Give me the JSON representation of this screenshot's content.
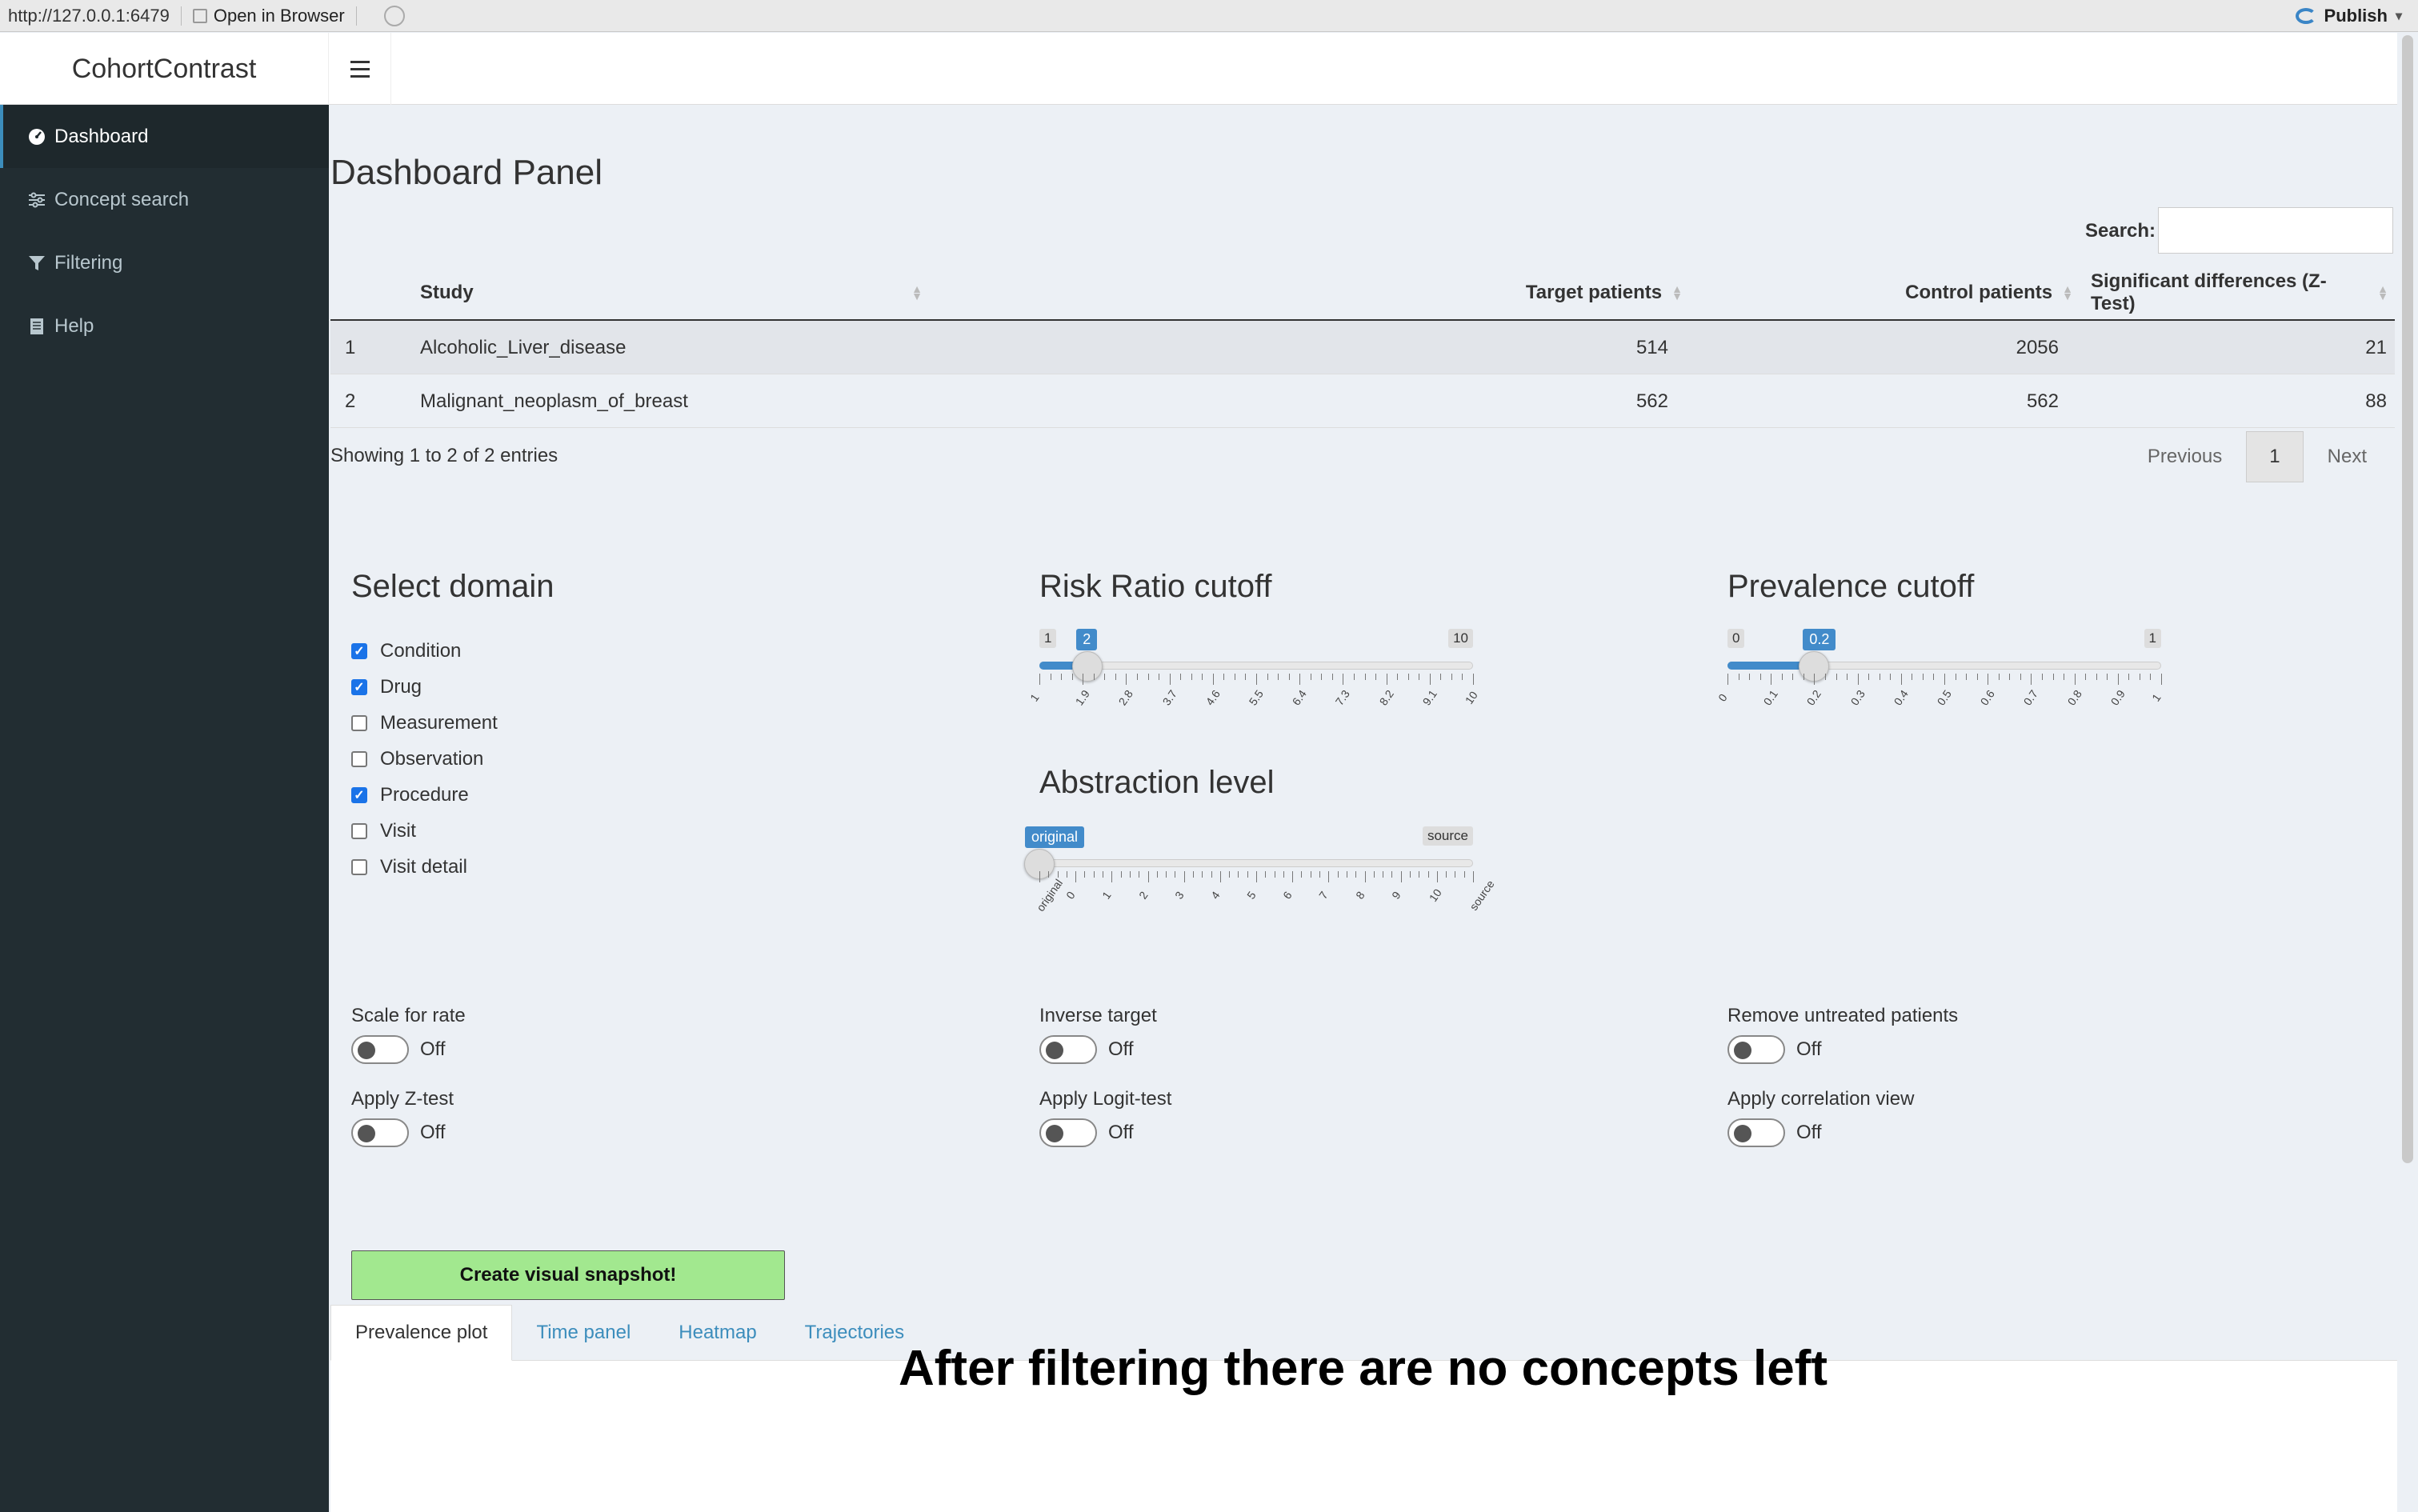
{
  "browser": {
    "url": "http://127.0.0.1:6479",
    "open_label": "Open in Browser",
    "publish_label": "Publish"
  },
  "app": {
    "title": "CohortContrast"
  },
  "sidebar": {
    "items": [
      {
        "label": "Dashboard",
        "icon": "dashboard-icon",
        "active": true
      },
      {
        "label": "Concept search",
        "icon": "sliders-icon",
        "active": false
      },
      {
        "label": "Filtering",
        "icon": "filter-icon",
        "active": false
      },
      {
        "label": "Help",
        "icon": "book-icon",
        "active": false
      }
    ]
  },
  "main": {
    "page_title": "Dashboard Panel",
    "search_label": "Search:",
    "search_value": "",
    "table": {
      "columns": [
        "Study",
        "Target patients",
        "Control patients",
        "Significant differences (Z-Test)"
      ],
      "rows": [
        {
          "idx": "1",
          "study": "Alcoholic_Liver_disease",
          "target": "514",
          "control": "2056",
          "sig": "21"
        },
        {
          "idx": "2",
          "study": "Malignant_neoplasm_of_breast",
          "target": "562",
          "control": "562",
          "sig": "88"
        }
      ]
    },
    "info": "Showing 1 to 2 of 2 entries",
    "pager": {
      "prev": "Previous",
      "current": "1",
      "next": "Next"
    }
  },
  "domain": {
    "title": "Select domain",
    "options": [
      {
        "label": "Condition",
        "checked": true
      },
      {
        "label": "Drug",
        "checked": true
      },
      {
        "label": "Measurement",
        "checked": false
      },
      {
        "label": "Observation",
        "checked": false
      },
      {
        "label": "Procedure",
        "checked": true
      },
      {
        "label": "Visit",
        "checked": false
      },
      {
        "label": "Visit detail",
        "checked": false
      }
    ]
  },
  "risk_ratio": {
    "title": "Risk Ratio cutoff",
    "min_label": "1",
    "max_label": "10",
    "value_label": "2",
    "value": 2,
    "min": 1,
    "max": 10,
    "tick_labels": [
      "1",
      "1.9",
      "2.8",
      "3.7",
      "4.6",
      "5.5",
      "6.4",
      "7.3",
      "8.2",
      "9.1",
      "10"
    ]
  },
  "prevalence": {
    "title": "Prevalence cutoff",
    "min_label": "0",
    "max_label": "1",
    "value_label": "0.2",
    "value": 0.2,
    "min": 0,
    "max": 1,
    "tick_labels": [
      "0",
      "0.1",
      "0.2",
      "0.3",
      "0.4",
      "0.5",
      "0.6",
      "0.7",
      "0.8",
      "0.9",
      "1"
    ]
  },
  "abstraction": {
    "title": "Abstraction level",
    "min_label": "original",
    "max_label": "source",
    "value_label": "original",
    "value_fraction": 0,
    "tick_labels": [
      "original",
      "0",
      "1",
      "2",
      "3",
      "4",
      "5",
      "6",
      "7",
      "8",
      "9",
      "10",
      "source"
    ]
  },
  "toggles": [
    {
      "label": "Scale for rate",
      "state": "Off"
    },
    {
      "label": "Inverse target",
      "state": "Off"
    },
    {
      "label": "Remove untreated patients",
      "state": "Off"
    },
    {
      "label": "Apply Z-test",
      "state": "Off"
    },
    {
      "label": "Apply Logit-test",
      "state": "Off"
    },
    {
      "label": "Apply correlation view",
      "state": "Off"
    }
  ],
  "snapshot_label": "Create visual snapshot!",
  "tabs": [
    "Prevalence plot",
    "Time panel",
    "Heatmap",
    "Trajectories"
  ],
  "empty_message": "After filtering there are no concepts left"
}
